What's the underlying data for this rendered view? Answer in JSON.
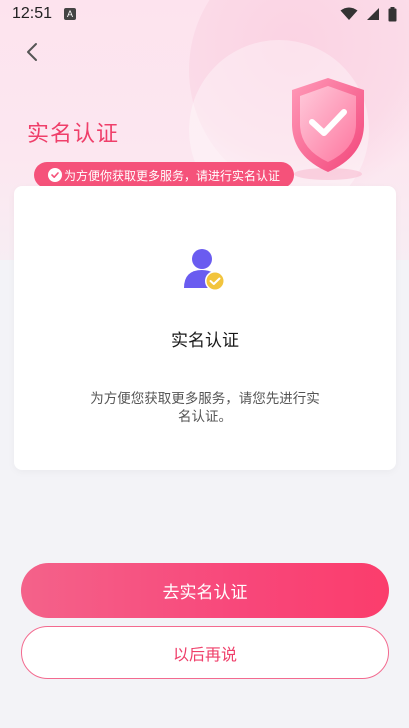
{
  "status_bar": {
    "time": "12:51",
    "notification_icon": "a-letter-icon",
    "notification_letter": "A",
    "wifi_icon": "wifi-icon",
    "signal_icon": "signal-icon",
    "battery_icon": "battery-icon"
  },
  "header": {
    "back_icon": "chevron-left-icon",
    "title": "实名认证",
    "tip": "为方便你获取更多服务，请进行实名认证",
    "tip_icon": "check-circle-icon",
    "illustration": "shield-check-icon"
  },
  "card": {
    "icon": "user-verified-icon",
    "title": "实名认证",
    "description": "为方便您获取更多服务，请您先进行实名认证。"
  },
  "actions": {
    "primary_label": "去实名认证",
    "secondary_label": "以后再说"
  },
  "colors": {
    "accent": "#ef3f6a",
    "primary_gradient_start": "#f4628a",
    "primary_gradient_end": "#fb3d6c",
    "avatar_blue": "#6a5cf0",
    "badge_yellow": "#f2c43d"
  }
}
